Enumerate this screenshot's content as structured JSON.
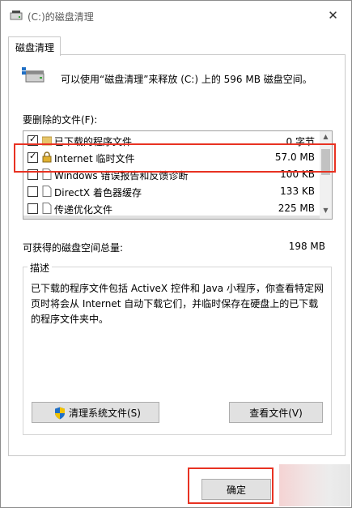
{
  "window": {
    "title": "(C:)的磁盘清理",
    "close_glyph": "✕"
  },
  "tab": {
    "label": "磁盘清理"
  },
  "intro": "可以使用“磁盘清理”来释放 (C:) 上的 596 MB 磁盘空间。",
  "files_label": "要删除的文件(F):",
  "files": [
    {
      "name": "已下载的程序文件",
      "size": "0 字节",
      "checked": true,
      "icon": "folder-icon"
    },
    {
      "name": "Internet 临时文件",
      "size": "57.0 MB",
      "checked": true,
      "icon": "lock-icon"
    },
    {
      "name": "Windows 错误报告和反馈诊断",
      "size": "100 KB",
      "checked": false,
      "icon": "file-icon"
    },
    {
      "name": "DirectX 着色器缓存",
      "size": "133 KB",
      "checked": false,
      "icon": "file-icon"
    },
    {
      "name": "传递优化文件",
      "size": "225 MB",
      "checked": false,
      "icon": "file-icon"
    }
  ],
  "space": {
    "label": "可获得的磁盘空间总量:",
    "value": "198 MB"
  },
  "description": {
    "legend": "描述",
    "text": "已下载的程序文件包括 ActiveX 控件和 Java 小程序，你查看特定网页时将会从 Internet 自动下载它们，并临时保存在硬盘上的已下载的程序文件夹中。"
  },
  "buttons": {
    "clean_system": "清理系统文件(S)",
    "view_files": "查看文件(V)",
    "ok": "确定"
  },
  "colors": {
    "highlight": "#e83222",
    "shield_blue": "#1f6fc5",
    "shield_yellow": "#f2c200"
  }
}
